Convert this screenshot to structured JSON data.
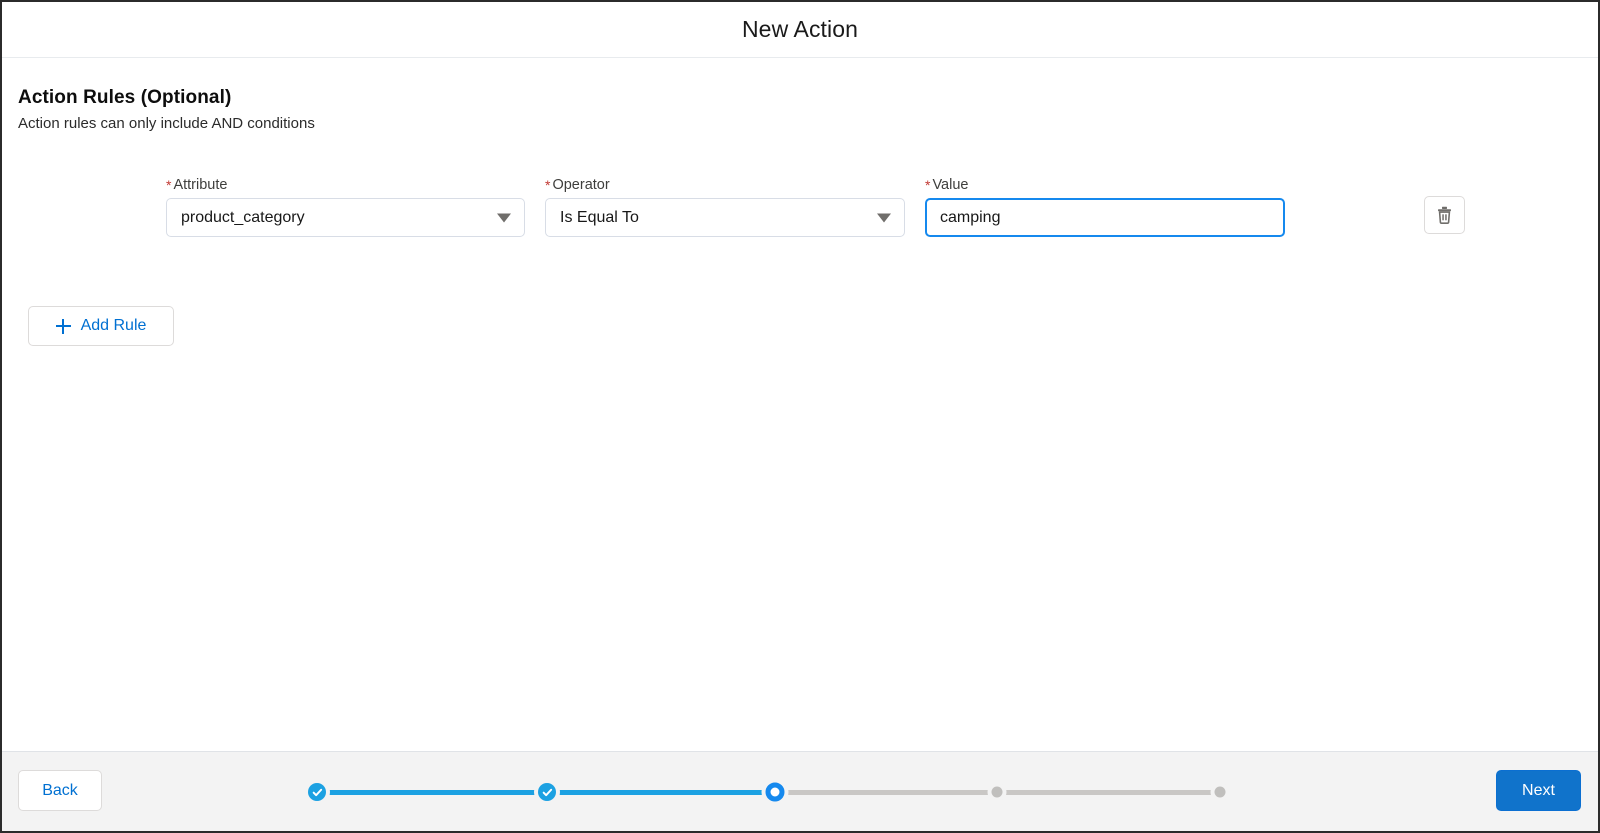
{
  "header": {
    "title": "New Action"
  },
  "section": {
    "title": "Action Rules (Optional)",
    "subtitle": "Action rules can only include AND conditions"
  },
  "rule": {
    "required_marker": "*",
    "attribute": {
      "label": "Attribute",
      "value": "product_category",
      "icon": "chevron-down-icon"
    },
    "operator": {
      "label": "Operator",
      "value": "Is Equal To",
      "icon": "chevron-down-icon"
    },
    "value": {
      "label": "Value",
      "value": "camping",
      "placeholder": "",
      "focused": true
    },
    "delete_icon": "trash-icon"
  },
  "add_rule": {
    "label": "Add Rule",
    "icon": "plus-icon"
  },
  "footer": {
    "back_label": "Back",
    "next_label": "Next",
    "progress": {
      "total_steps": 5,
      "current_step": 3,
      "states": [
        "done",
        "done",
        "active",
        "todo",
        "todo"
      ]
    }
  },
  "colors": {
    "accent_blue": "#1589ee",
    "link_blue": "#0070d2",
    "primary_button": "#1073cb",
    "required_red": "#c23934",
    "progress_done": "#1ca1e2",
    "progress_todo": "#c9c7c5",
    "footer_bg": "#f3f3f3"
  }
}
